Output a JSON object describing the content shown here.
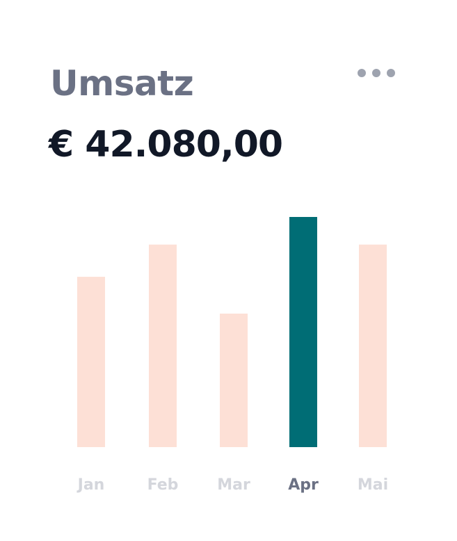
{
  "card": {
    "title": "Umsatz",
    "amount": "€ 42.080,00",
    "menu_icon": "more-horizontal-icon"
  },
  "colors": {
    "bar": "#fde0d6",
    "bar_active": "#006d75",
    "label": "#d4d6dc",
    "label_active": "#6b7184"
  },
  "chart_data": {
    "type": "bar",
    "categories": [
      "Jan",
      "Feb",
      "Mar",
      "Apr",
      "Mai"
    ],
    "values": [
      74,
      88,
      58,
      100,
      88
    ],
    "highlighted": "Apr",
    "ylim": [
      0,
      100
    ],
    "grid": false,
    "title": "",
    "xlabel": "",
    "ylabel": ""
  }
}
